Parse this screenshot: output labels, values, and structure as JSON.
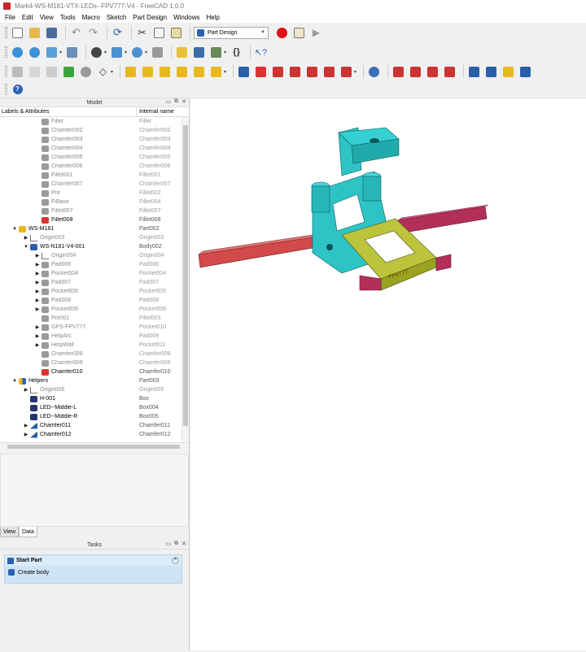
{
  "window": {
    "title": "Mark4-WS-M181-VTX-LEDs--FPV777-V4 - FreeCAD 1.0.0"
  },
  "menu": [
    "File",
    "Edit",
    "View",
    "Tools",
    "Macro",
    "Sketch",
    "Part Design",
    "Windows",
    "Help"
  ],
  "toolbar": {
    "workbench": "Part Design"
  },
  "model_panel": {
    "title": "Model",
    "col_labels": "Labels & Attributes",
    "col_internal": "Internal name"
  },
  "tree": [
    {
      "label": "Fillet",
      "internal": "Fillet"
    },
    {
      "label": "Chamfer002",
      "internal": "Chamfer002"
    },
    {
      "label": "Chamfer003",
      "internal": "Chamfer003"
    },
    {
      "label": "Chamfer004",
      "internal": "Chamfer004"
    },
    {
      "label": "Chamfer005",
      "internal": "Chamfer005"
    },
    {
      "label": "Chamfer006",
      "internal": "Chamfer006"
    },
    {
      "label": "Fillet001",
      "internal": "Fillet001"
    },
    {
      "label": "Chamfer007",
      "internal": "Chamfer007"
    },
    {
      "label": "Pre",
      "internal": "Fillet002"
    },
    {
      "label": "FiBase",
      "internal": "Fillet004"
    },
    {
      "label": "Fillet007",
      "internal": "Fillet007"
    },
    {
      "label": "Fillet008",
      "internal": "Fillet008"
    },
    {
      "label": "WS-M181",
      "internal": "Part002"
    },
    {
      "label": "Origin003",
      "internal": "Origin003"
    },
    {
      "label": "WS-N181-V4-001",
      "internal": "Body002"
    },
    {
      "label": "Origin004",
      "internal": "Origin004"
    },
    {
      "label": "Pad006",
      "internal": "Pad006"
    },
    {
      "label": "Pocket004",
      "internal": "Pocket004"
    },
    {
      "label": "Pad007",
      "internal": "Pad007"
    },
    {
      "label": "Pocket005",
      "internal": "Pocket005"
    },
    {
      "label": "Pad008",
      "internal": "Pad008"
    },
    {
      "label": "Pocket009",
      "internal": "Pocket009"
    },
    {
      "label": "Pre001",
      "internal": "Fillet003"
    },
    {
      "label": "GPS-FPV777",
      "internal": "Pocket010"
    },
    {
      "label": "HelpArc",
      "internal": "Pad009"
    },
    {
      "label": "HelpWall",
      "internal": "Pocket011"
    },
    {
      "label": "Chamfer008",
      "internal": "Chamfer008"
    },
    {
      "label": "Chamfer009",
      "internal": "Chamfer009"
    },
    {
      "label": "Chamfer010",
      "internal": "Chamfer010"
    },
    {
      "label": "Helpers",
      "internal": "Part003"
    },
    {
      "label": "Origin005",
      "internal": "Origin005"
    },
    {
      "label": "H-001",
      "internal": "Box"
    },
    {
      "label": "LED--Middle-L",
      "internal": "Box004"
    },
    {
      "label": "LED--Middle-R",
      "internal": "Box005"
    },
    {
      "label": "Chamfer011",
      "internal": "Chamfer011"
    },
    {
      "label": "Chamfer012",
      "internal": "Chamfer012"
    }
  ],
  "tabs": [
    "View",
    "Data"
  ],
  "tasks_panel": {
    "title": "Tasks",
    "section": "Start Part",
    "item": "Create body"
  },
  "colors": {
    "accent": "#2a62b5",
    "cyan_part": "#29c6c8",
    "olive_part": "#b9c23a",
    "magenta_bar": "#c0305a",
    "red_bar": "#cf4a4a"
  }
}
